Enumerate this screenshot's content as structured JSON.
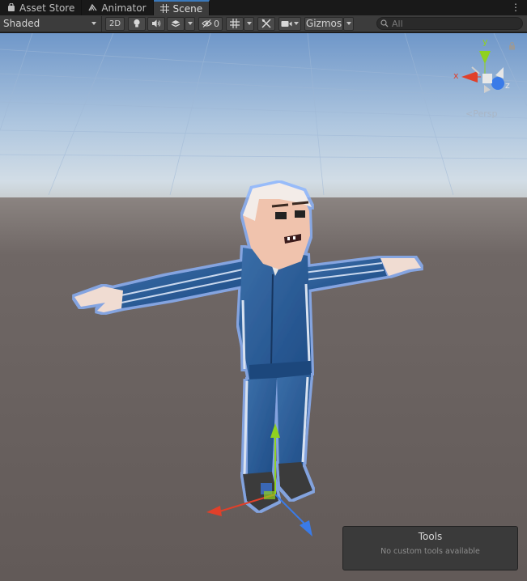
{
  "tabs": [
    {
      "label": "Asset Store",
      "icon": "shopping-bag-icon"
    },
    {
      "label": "Animator",
      "icon": "animator-icon"
    },
    {
      "label": "Scene",
      "icon": "grid-icon"
    }
  ],
  "toolbar": {
    "shading_mode": "Shaded",
    "mode_2d": "2D",
    "hidden_count": "0",
    "gizmos_label": "Gizmos",
    "search_placeholder": "All"
  },
  "orientation_gizmo": {
    "y": "y",
    "x": "x",
    "z": "z",
    "projection": "Persp"
  },
  "tools_overlay": {
    "title": "Tools",
    "message": "No custom tools available"
  },
  "colors": {
    "accent": "#3a79bb",
    "toolbar_bg": "#3c3c3c",
    "axis_x": "#e0402a",
    "axis_y": "#8fd11f",
    "axis_z": "#3a7be8"
  }
}
